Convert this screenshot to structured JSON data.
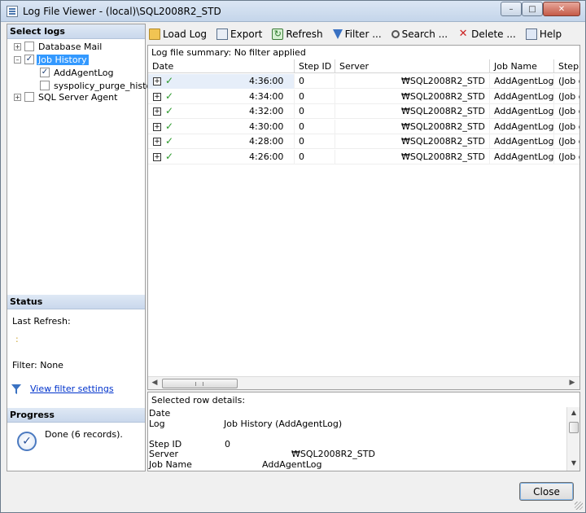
{
  "window": {
    "title": "Log File Viewer - (local)\\SQL2008R2_STD"
  },
  "left": {
    "select_logs_header": "Select logs",
    "tree": [
      {
        "label": "Database Mail",
        "checked": false
      },
      {
        "label": "Job History",
        "checked": true
      },
      {
        "label": "AddAgentLog",
        "checked": true
      },
      {
        "label": "syspolicy_purge_history",
        "checked": false
      },
      {
        "label": "SQL Server Agent",
        "checked": false
      }
    ],
    "status_header": "Status",
    "last_refresh_label": "Last Refresh:",
    "last_refresh_value": ":",
    "filter_text": "Filter: None",
    "view_filter_link": "View filter settings",
    "progress_header": "Progress",
    "progress_text": "Done (6 records)."
  },
  "toolbar": {
    "load_log": "Load Log",
    "export": "Export",
    "refresh": "Refresh",
    "filter": "Filter ...",
    "search": "Search ...",
    "delete": "Delete ...",
    "help": "Help"
  },
  "grid": {
    "summary": "Log file summary: No filter applied",
    "columns": [
      "Date",
      "Step ID",
      "Server",
      "Job Name",
      "Step"
    ],
    "rows": [
      {
        "time": "4:36:00",
        "step_id": "0",
        "server": "₩SQL2008R2_STD",
        "job_name": "AddAgentLog",
        "step": "(Job o"
      },
      {
        "time": "4:34:00",
        "step_id": "0",
        "server": "₩SQL2008R2_STD",
        "job_name": "AddAgentLog",
        "step": "(Job o"
      },
      {
        "time": "4:32:00",
        "step_id": "0",
        "server": "₩SQL2008R2_STD",
        "job_name": "AddAgentLog",
        "step": "(Job o"
      },
      {
        "time": "4:30:00",
        "step_id": "0",
        "server": "₩SQL2008R2_STD",
        "job_name": "AddAgentLog",
        "step": "(Job o"
      },
      {
        "time": "4:28:00",
        "step_id": "0",
        "server": "₩SQL2008R2_STD",
        "job_name": "AddAgentLog",
        "step": "(Job o"
      },
      {
        "time": "4:26:00",
        "step_id": "0",
        "server": "₩SQL2008R2_STD",
        "job_name": "AddAgentLog",
        "step": "(Job o"
      }
    ]
  },
  "details": {
    "title": "Selected row details:",
    "date_label": "Date",
    "log_label": "Log",
    "log_value": "Job History (AddAgentLog)",
    "step_id_label": "Step ID",
    "step_id_value": "0",
    "server_label": "Server",
    "server_value": "₩SQL2008R2_STD",
    "job_name_label": "Job Name",
    "job_name_value": "AddAgentLog"
  },
  "footer": {
    "close_label": "Close"
  }
}
